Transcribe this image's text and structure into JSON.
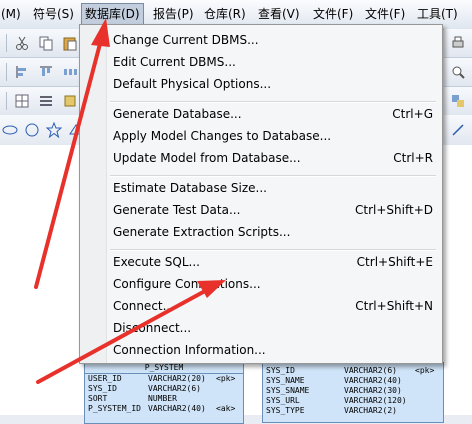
{
  "menubar": {
    "items": [
      "(M)",
      "符号(S)",
      "数据库(D)",
      "报告(P)",
      "仓库(R)",
      "查看(V)",
      "文件(F)",
      "文件(F)",
      "工具(T)"
    ]
  },
  "menu": {
    "items": [
      {
        "label": "Change Current DBMS...",
        "shortcut": ""
      },
      {
        "label": "Edit Current DBMS...",
        "shortcut": ""
      },
      {
        "label": "Default Physical Options...",
        "shortcut": ""
      },
      {
        "label": "Generate Database...",
        "shortcut": "Ctrl+G"
      },
      {
        "label": "Apply Model Changes to Database...",
        "shortcut": ""
      },
      {
        "label": "Update Model from Database...",
        "shortcut": "Ctrl+R"
      },
      {
        "label": "Estimate Database Size...",
        "shortcut": ""
      },
      {
        "label": "Generate Test Data...",
        "shortcut": "Ctrl+Shift+D"
      },
      {
        "label": "Generate Extraction Scripts...",
        "shortcut": ""
      },
      {
        "label": "Execute SQL...",
        "shortcut": "Ctrl+Shift+E"
      },
      {
        "label": "Configure Connections...",
        "shortcut": ""
      },
      {
        "label": "Connect...",
        "shortcut": "Ctrl+Shift+N"
      },
      {
        "label": "Disconnect...",
        "shortcut": ""
      },
      {
        "label": "Connection Information...",
        "shortcut": ""
      }
    ]
  },
  "table1": {
    "title": "P_SYSTEM",
    "rows": [
      [
        "USER_ID",
        "VARCHAR2(20)",
        "<pk>"
      ],
      [
        "SYS_ID",
        "VARCHAR2(6)",
        ""
      ],
      [
        "SORT",
        "NUMBER",
        ""
      ],
      [
        "P_SYSTEM_ID",
        "VARCHAR2(40)",
        "<ak>"
      ]
    ]
  },
  "table2": {
    "rows": [
      [
        "SYS_ID",
        "VARCHAR2(6)",
        "<pk>"
      ],
      [
        "SYS_NAME",
        "VARCHAR2(40)",
        ""
      ],
      [
        "SYS_SNAME",
        "VARCHAR2(30)",
        ""
      ],
      [
        "SYS_URL",
        "VARCHAR2(120)",
        ""
      ],
      [
        "SYS_TYPE",
        "VARCHAR2(2)",
        ""
      ]
    ]
  },
  "colors": {
    "arrow": "#e8312a",
    "menu_bg": "#f5f6f7",
    "table_bg": "#cfe4f8"
  }
}
